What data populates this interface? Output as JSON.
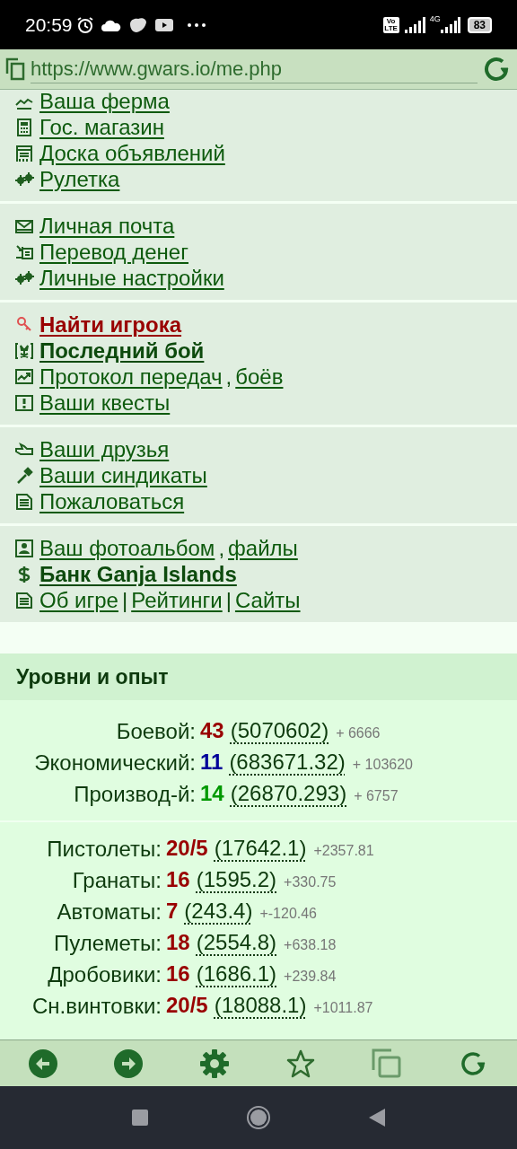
{
  "status_bar": {
    "time": "20:59",
    "volte": "Vo LTE",
    "network": "4G",
    "battery": "83"
  },
  "address_bar": {
    "url": "https://www.gwars.io/me.php"
  },
  "menu_sections": [
    {
      "items": [
        {
          "parts": [
            {
              "link": "Ваша ферма",
              "bold": false,
              "alert": false
            }
          ]
        },
        {
          "parts": [
            {
              "link": "Гос. магазин",
              "bold": false,
              "alert": false
            }
          ]
        },
        {
          "parts": [
            {
              "link": "Доска объявлений",
              "bold": false,
              "alert": false
            }
          ]
        },
        {
          "parts": [
            {
              "link": "Рулетка",
              "bold": false,
              "alert": false
            }
          ]
        }
      ]
    },
    {
      "items": [
        {
          "parts": [
            {
              "link": "Личная почта",
              "bold": false,
              "alert": false
            }
          ]
        },
        {
          "parts": [
            {
              "link": "Перевод денег",
              "bold": false,
              "alert": false
            }
          ]
        },
        {
          "parts": [
            {
              "link": "Личные настройки",
              "bold": false,
              "alert": false
            }
          ]
        }
      ]
    },
    {
      "items": [
        {
          "parts": [
            {
              "link": "Найти игрока",
              "bold": true,
              "alert": true
            }
          ]
        },
        {
          "parts": [
            {
              "link": "Последний бой",
              "bold": true,
              "alert": false
            }
          ]
        },
        {
          "parts": [
            {
              "link": "Протокол передач",
              "bold": false,
              "alert": false
            },
            {
              "separator": ","
            },
            {
              "link": "боёв",
              "bold": false,
              "alert": false
            }
          ]
        },
        {
          "parts": [
            {
              "link": "Ваши квесты",
              "bold": false,
              "alert": false
            }
          ]
        }
      ]
    },
    {
      "items": [
        {
          "parts": [
            {
              "link": "Ваши друзья",
              "bold": false,
              "alert": false
            }
          ]
        },
        {
          "parts": [
            {
              "link": "Ваши синдикаты",
              "bold": false,
              "alert": false
            }
          ]
        },
        {
          "parts": [
            {
              "link": "Пожаловаться",
              "bold": false,
              "alert": false
            }
          ]
        }
      ]
    },
    {
      "items": [
        {
          "parts": [
            {
              "link": "Ваш фотоальбом",
              "bold": false,
              "alert": false
            },
            {
              "separator": ","
            },
            {
              "link": "файлы",
              "bold": false,
              "alert": false
            }
          ]
        },
        {
          "parts": [
            {
              "link": "Банк Ganja Islands",
              "bold": true,
              "alert": false
            }
          ]
        },
        {
          "parts": [
            {
              "link": "Об игре",
              "bold": false,
              "alert": false
            },
            {
              "separator": "|"
            },
            {
              "link": "Рейтинги",
              "bold": false,
              "alert": false
            },
            {
              "separator": "|"
            },
            {
              "link": "Сайты",
              "bold": false,
              "alert": false
            }
          ]
        }
      ]
    }
  ],
  "levels_panel": {
    "title": "Уровни и опыт",
    "levels": [
      {
        "label": "Боевой:",
        "value": "43",
        "color": "#990000",
        "exp": "(5070602)",
        "gain": "+ 6666"
      },
      {
        "label": "Экономический:",
        "value": "11",
        "color": "#000099",
        "exp": "(683671.32)",
        "gain": "+ 103620"
      },
      {
        "label": "Производ-й:",
        "value": "14",
        "color": "#009900",
        "exp": "(26870.293)",
        "gain": "+ 6757"
      }
    ],
    "skills": [
      {
        "label": "Пистолеты:",
        "value": "20/5",
        "color": "#990000",
        "exp": "(17642.1)",
        "gain": "+2357.81"
      },
      {
        "label": "Гранаты:",
        "value": "16",
        "color": "#990000",
        "exp": "(1595.2)",
        "gain": "+330.75"
      },
      {
        "label": "Автоматы:",
        "value": "7",
        "color": "#990000",
        "exp": "(243.4)",
        "gain": "+-120.46"
      },
      {
        "label": "Пулеметы:",
        "value": "18",
        "color": "#990000",
        "exp": "(2554.8)",
        "gain": "+638.18"
      },
      {
        "label": "Дробовики:",
        "value": "16",
        "color": "#990000",
        "exp": "(1686.1)",
        "gain": "+239.84"
      },
      {
        "label": "Сн.винтовки:",
        "value": "20/5",
        "color": "#990000",
        "exp": "(18088.1)",
        "gain": "+1011.87"
      }
    ]
  }
}
